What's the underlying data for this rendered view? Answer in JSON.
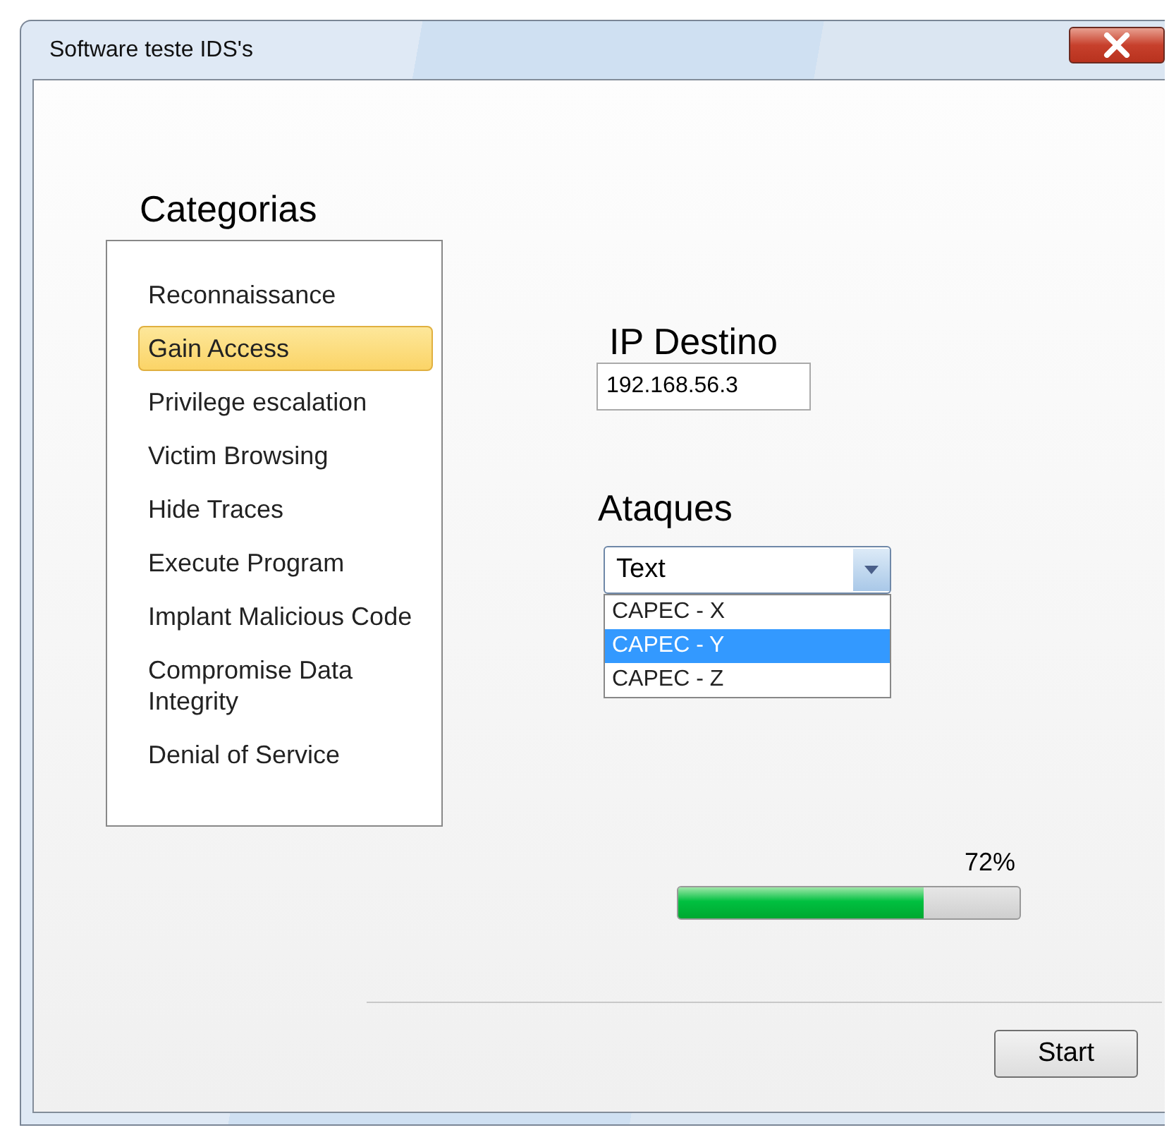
{
  "window": {
    "title": "Software teste IDS's"
  },
  "categories": {
    "heading": "Categorias",
    "items": [
      {
        "label": "Reconnaissance",
        "selected": false
      },
      {
        "label": "Gain Access",
        "selected": true
      },
      {
        "label": "Privilege escalation",
        "selected": false
      },
      {
        "label": "Victim Browsing",
        "selected": false
      },
      {
        "label": "Hide Traces",
        "selected": false
      },
      {
        "label": "Execute Program",
        "selected": false
      },
      {
        "label": "Implant Malicious Code",
        "selected": false
      },
      {
        "label": "Compromise Data Integrity",
        "selected": false
      },
      {
        "label": "Denial of Service",
        "selected": false
      }
    ]
  },
  "ip": {
    "label": "IP Destino",
    "value": "192.168.56.3"
  },
  "attacks": {
    "label": "Ataques",
    "value": "Text",
    "expanded": true,
    "options": [
      {
        "label": "CAPEC - X",
        "selected": false
      },
      {
        "label": "CAPEC - Y",
        "selected": true
      },
      {
        "label": "CAPEC - Z",
        "selected": false
      }
    ]
  },
  "progress": {
    "reading": "72%",
    "level": 0.72
  },
  "buttons": [
    "Start"
  ]
}
